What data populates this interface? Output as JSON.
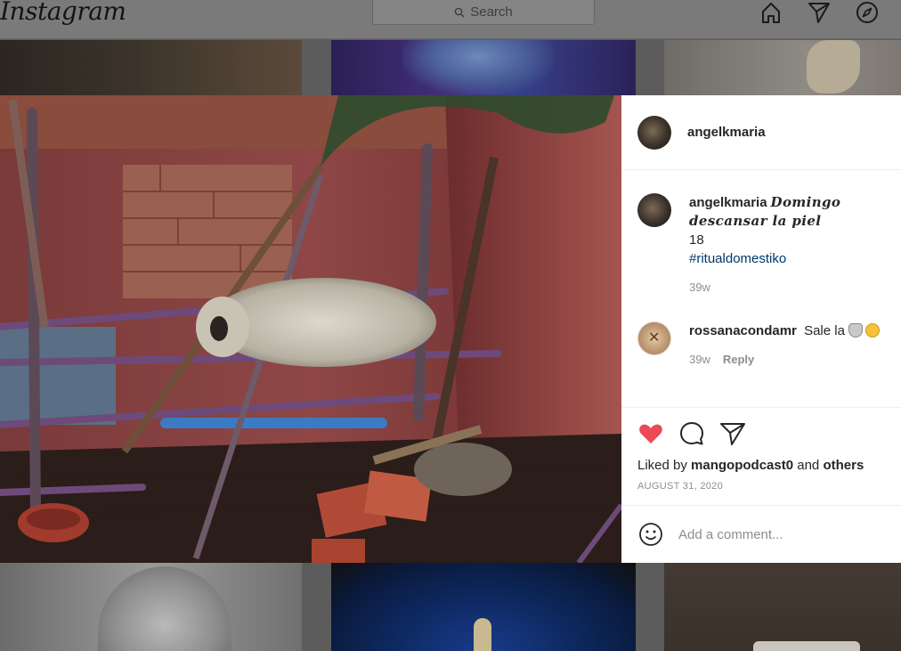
{
  "topbar": {
    "logo": "Instagram",
    "search_placeholder": "Search",
    "icons": [
      "home-icon",
      "direct-icon",
      "explore-icon"
    ]
  },
  "post": {
    "username": "angelkmaria",
    "caption": {
      "username": "angelkmaria",
      "text": "Domingo descansar la piel",
      "line2": "18",
      "hashtag": "#ritualdomestiko",
      "time": "39w"
    },
    "comments": [
      {
        "username": "rossanacondamr",
        "text": "Sale la",
        "emojis": [
          "wolf-emoji",
          "yellow-circle-emoji"
        ],
        "time": "39w",
        "reply_label": "Reply"
      }
    ],
    "liked_by_prefix": "Liked by",
    "liked_by_user": "mangopodcast0",
    "liked_by_middle": "and",
    "liked_by_others": "others",
    "date": "AUGUST 31, 2020",
    "add_comment_placeholder": "Add a comment...",
    "like_color": "#ed4956"
  }
}
